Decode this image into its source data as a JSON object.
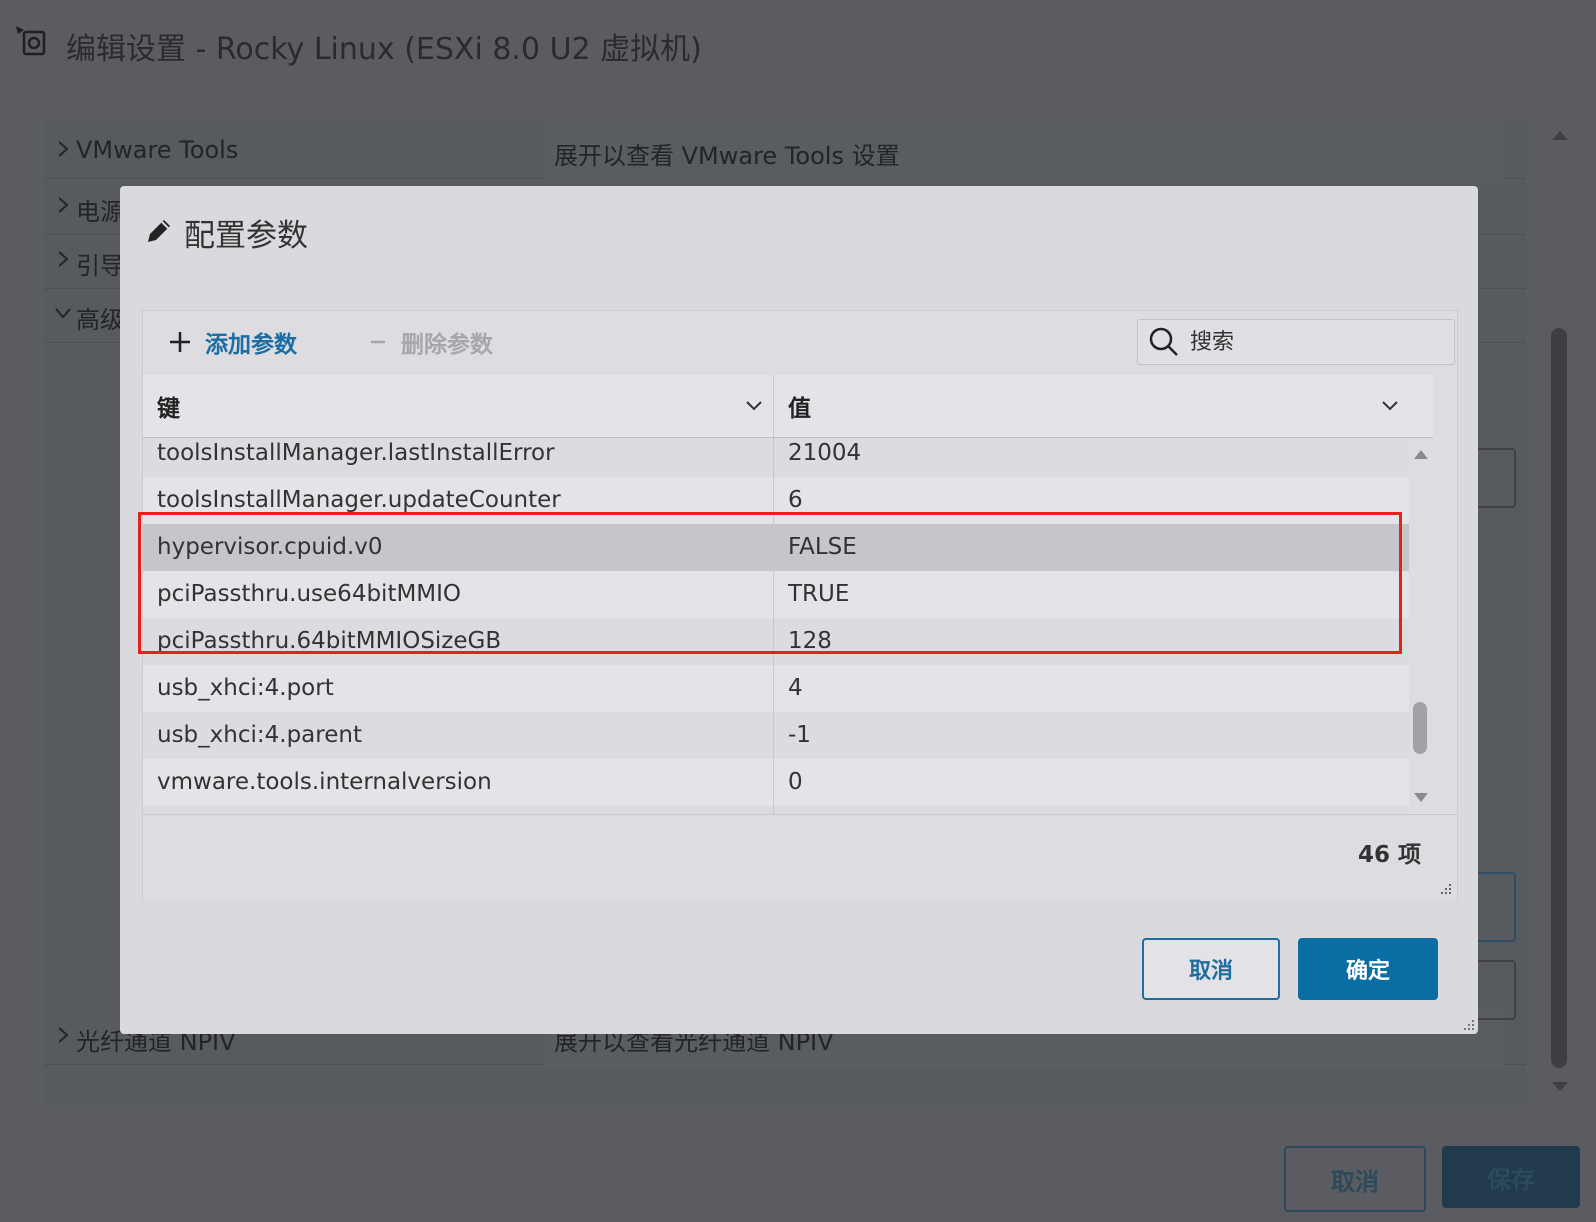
{
  "window": {
    "title": "编辑设置 - Rocky Linux (ESXi 8.0 U2 虚拟机)"
  },
  "background": {
    "rows": [
      {
        "label": "VMware Tools",
        "value": "展开以查看 VMware Tools 设置"
      },
      {
        "label": "电源",
        "value": ""
      },
      {
        "label": "引导",
        "value": ""
      },
      {
        "label": "高级",
        "value": ""
      },
      {
        "label": "光纤通道 NPIV",
        "value": "展开以查看光纤通道 NPIV"
      }
    ],
    "cancel_label": "取消",
    "save_label": "保存"
  },
  "modal": {
    "title": "配置参数",
    "toolbar": {
      "add_label": "添加参数",
      "delete_label": "删除参数",
      "search_placeholder": "搜索"
    },
    "columns": {
      "key": "键",
      "value": "值"
    },
    "rows": [
      {
        "key": "toolsInstallManager.lastInstallError",
        "value": "21004"
      },
      {
        "key": "toolsInstallManager.updateCounter",
        "value": "6"
      },
      {
        "key": "hypervisor.cpuid.v0",
        "value": "FALSE"
      },
      {
        "key": "pciPassthru.use64bitMMIO",
        "value": "TRUE"
      },
      {
        "key": "pciPassthru.64bitMMIOSizeGB",
        "value": "128"
      },
      {
        "key": "usb_xhci:4.port",
        "value": "4"
      },
      {
        "key": "usb_xhci:4.parent",
        "value": "-1"
      },
      {
        "key": "vmware.tools.internalversion",
        "value": "0"
      }
    ],
    "count_label": "46 项",
    "cancel_label": "取消",
    "ok_label": "确定"
  },
  "colors": {
    "accent": "#0a6ea3",
    "highlight_box": "#e3231b",
    "selected_row": "#c5c5cb"
  },
  "icons": [
    "settings-dialog-icon",
    "chevron-right-icon",
    "chevron-down-icon",
    "pencil-icon",
    "plus-icon",
    "minus-icon",
    "search-icon",
    "resize-grip-icon"
  ]
}
